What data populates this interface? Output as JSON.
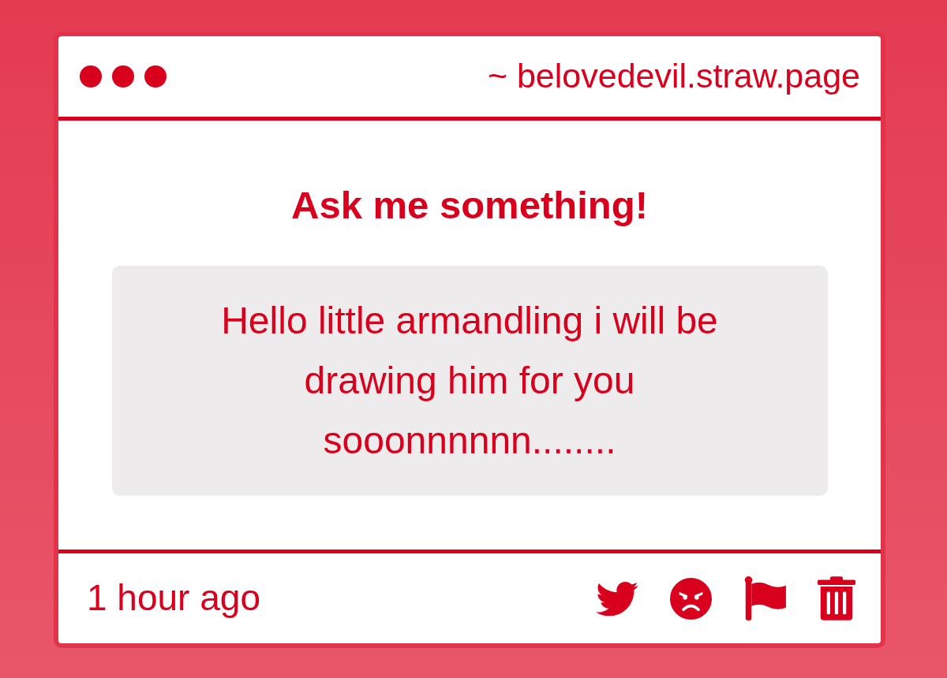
{
  "address_bar": {
    "url": "~ belovedevil.straw.page"
  },
  "question": {
    "title": "Ask me something!",
    "message": "Hello little armandling i will be drawing him for you sooonnnnnn........"
  },
  "footer": {
    "time": "1 hour ago"
  }
}
